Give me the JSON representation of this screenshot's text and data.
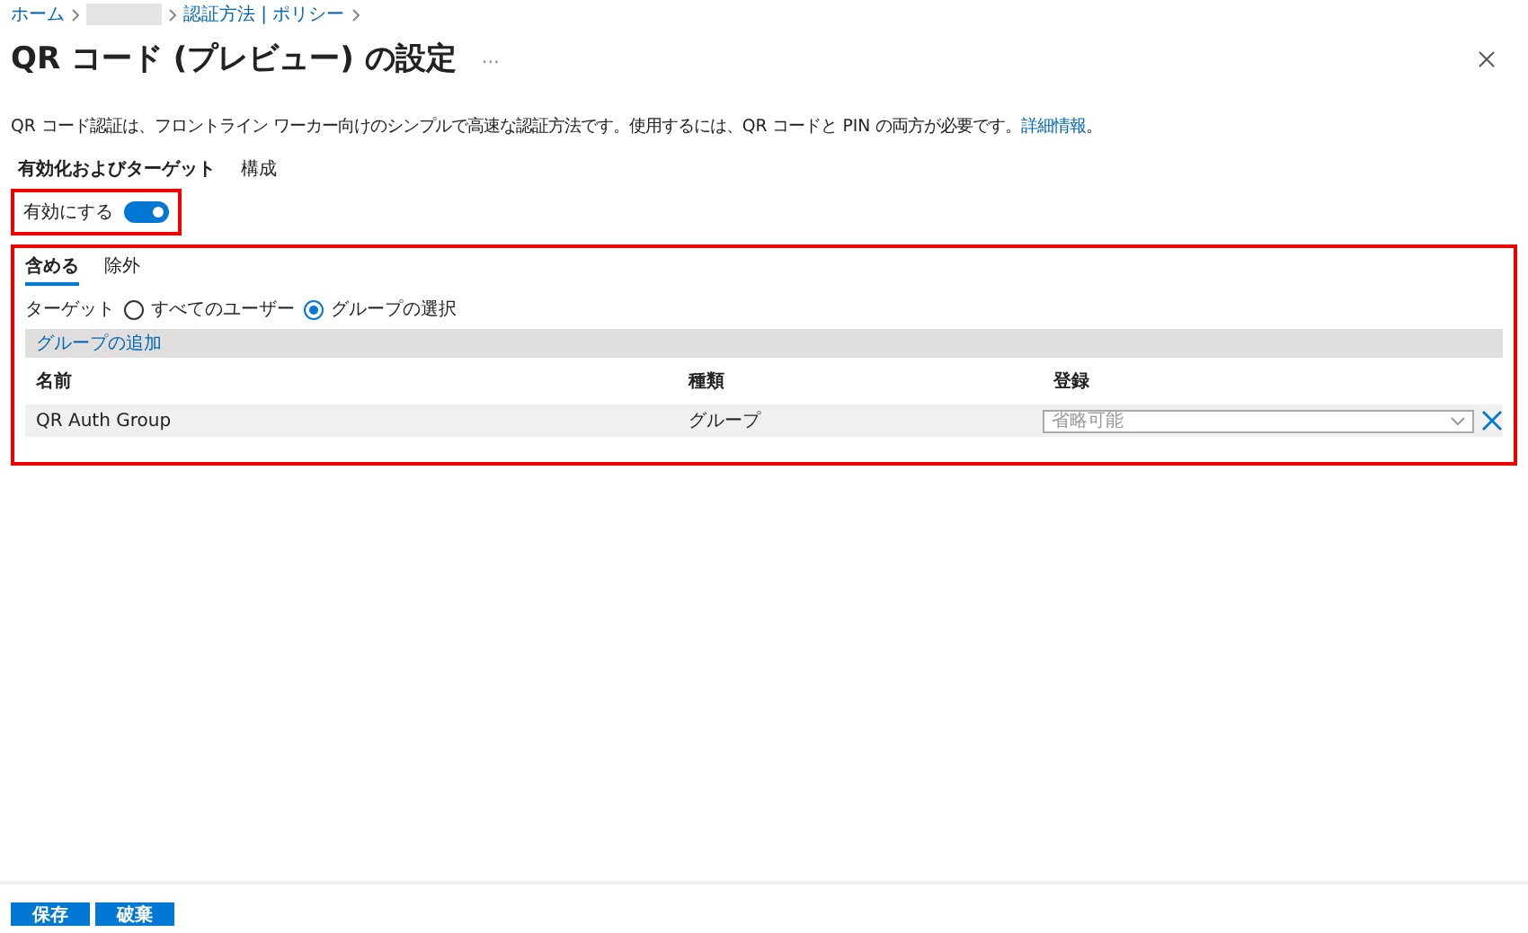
{
  "breadcrumb": {
    "items": [
      {
        "label": "ホーム",
        "kind": "link"
      },
      {
        "kind": "redacted"
      },
      {
        "label": "認証方法 | ポリシー",
        "kind": "link"
      }
    ]
  },
  "title": "QR コード (プレビュー) の設定",
  "more": "…",
  "description": {
    "text": "QR コード認証は、フロントライン ワーカー向けのシンプルで高速な認証方法です。使用するには、QR コードと PIN の両方が必要です。",
    "link": "詳細情報",
    "tail": "。"
  },
  "tabs": [
    {
      "label": "有効化およびターゲット",
      "selected": true
    },
    {
      "label": "構成",
      "selected": false
    }
  ],
  "enable": {
    "label": "有効にする",
    "on": true
  },
  "subtabs": [
    {
      "label": "含める",
      "selected": true
    },
    {
      "label": "除外",
      "selected": false
    }
  ],
  "target": {
    "label": "ターゲット",
    "options": [
      {
        "label": "すべてのユーザー",
        "selected": false
      },
      {
        "label": "グループの選択",
        "selected": true
      }
    ]
  },
  "add_group": "グループの追加",
  "table": {
    "columns": [
      "名前",
      "種類",
      "登録"
    ],
    "rows": [
      {
        "name": "QR Auth Group",
        "type": "グループ",
        "registration": "省略可能"
      }
    ]
  },
  "buttons": [
    "保存",
    "破棄"
  ]
}
